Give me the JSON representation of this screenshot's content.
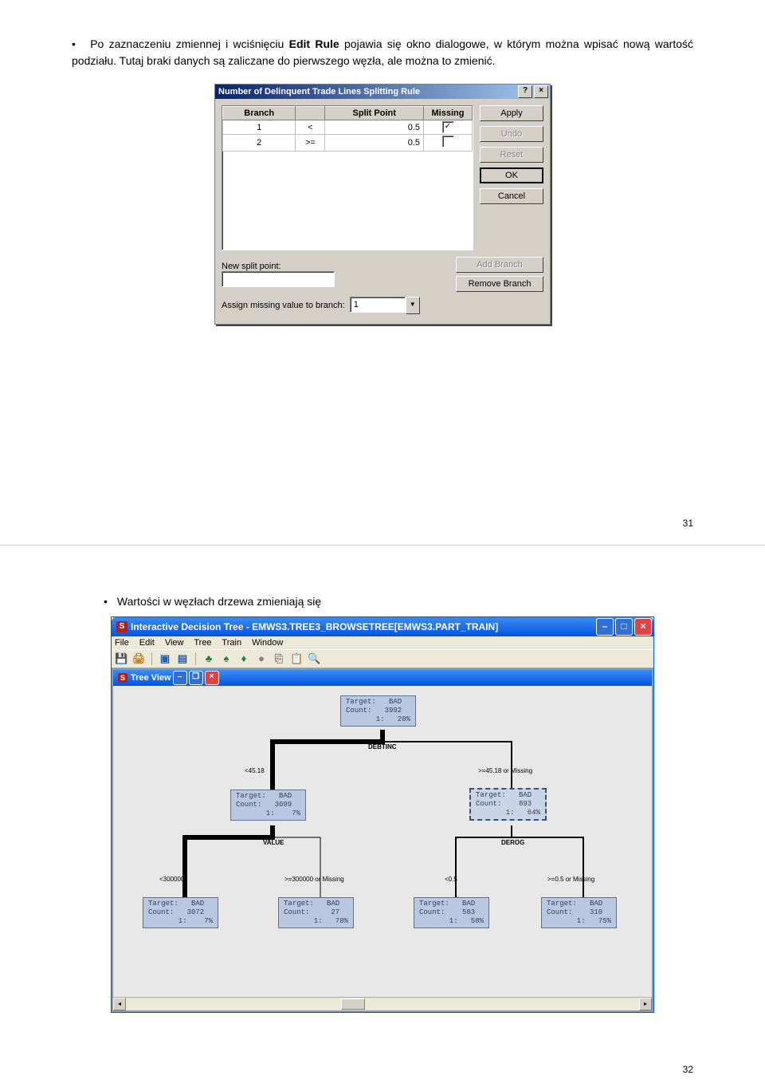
{
  "page1": {
    "bullet_text_before": "Po zaznaczeniu zmiennej i wciśnięciu ",
    "bullet_bold": "Edit Rule",
    "bullet_text_after": " pojawia się okno dialogowe, w którym można wpisać nową wartość podziału. Tutaj braki danych są zaliczane do pierwszego węzła, ale można to zmienić.",
    "dialog": {
      "title": "Number of Delinquent Trade Lines Splitting Rule",
      "help_btn": "?",
      "close_btn": "×",
      "headers": {
        "branch": "Branch",
        "op": "",
        "split_point": "Split Point",
        "missing": "Missing"
      },
      "rows": [
        {
          "branch": "1",
          "op": "<",
          "split_point": "0.5",
          "missing_checked": true
        },
        {
          "branch": "2",
          "op": ">=",
          "split_point": "0.5",
          "missing_checked": false
        }
      ],
      "buttons": {
        "apply": "Apply",
        "undo": "Undo",
        "reset": "Reset",
        "ok": "OK",
        "cancel": "Cancel"
      },
      "new_split_label": "New split point:",
      "add_branch": "Add Branch",
      "remove_branch": "Remove Branch",
      "assign_missing_label": "Assign missing value to branch:",
      "assign_missing_value": "1"
    },
    "page_number": "31"
  },
  "page2": {
    "bullet_text": "Wartości w węzłach drzewa zmieniają się",
    "window": {
      "title": "Interactive Decision Tree - EMWS3.TREE3_BROWSETREE[EMWS3.PART_TRAIN]",
      "sas_icon_text": "S",
      "menus": [
        "File",
        "Edit",
        "View",
        "Tree",
        "Train",
        "Window"
      ],
      "inner_title": "Tree View",
      "toolbar_icons": [
        "save-icon",
        "print-icon",
        "sep",
        "tree1-icon",
        "tree2-icon",
        "sep",
        "branch1-icon",
        "branch2-icon",
        "branch3-icon",
        "circle-icon",
        "copy-icon",
        "paste-icon",
        "find-icon"
      ]
    },
    "nodes": {
      "root": {
        "line1": "Target:   BAD",
        "line2": "Count:   3992",
        "line3": "       1:   20%"
      },
      "left": {
        "line1": "Target:   BAD",
        "line2": "Count:   3099",
        "line3": "       1:    7%"
      },
      "right": {
        "line1": "Target:   BAD",
        "line2": "Count:    893",
        "line3": "       1:   64%"
      },
      "ll": {
        "line1": "Target:   BAD",
        "line2": "Count:   3072",
        "line3": "       1:    7%"
      },
      "lr": {
        "line1": "Target:   BAD",
        "line2": "Count:     27",
        "line3": "       1:   78%"
      },
      "rl": {
        "line1": "Target:   BAD",
        "line2": "Count:    583",
        "line3": "       1:   58%"
      },
      "rr": {
        "line1": "Target:   BAD",
        "line2": "Count:    310",
        "line3": "       1:   75%"
      }
    },
    "splits": {
      "root_var": "DEBTINC",
      "left_var": "VALUE",
      "right_var": "DEROG",
      "root_left_br": "<45.18",
      "root_right_br": ">=45.18 or Missing",
      "left_left_br": "<300000",
      "left_right_br": ">=300000 or Missing",
      "right_left_br": "<0.5",
      "right_right_br": ">=0.5 or Missing"
    },
    "page_number": "32"
  }
}
